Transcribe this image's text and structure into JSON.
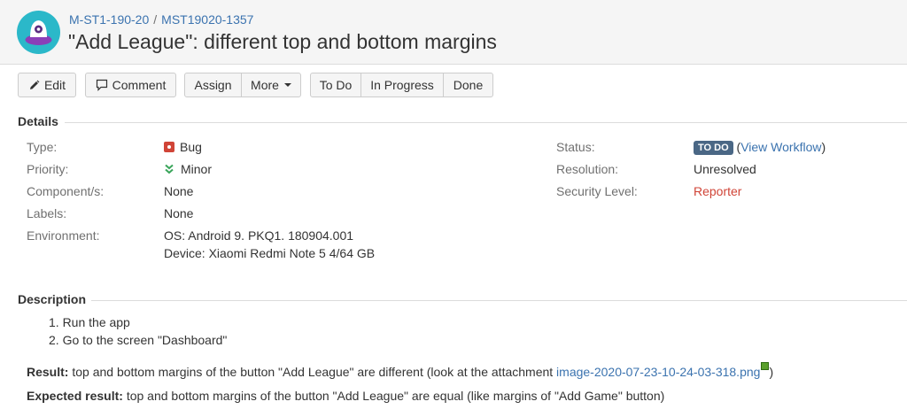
{
  "header": {
    "breadcrumb": [
      "M-ST1-190-20",
      "MST19020-1357"
    ],
    "breadcrumb_separator": "/",
    "title": "\"Add League\": different top and bottom margins",
    "avatar_icon": "project-avatar-icon"
  },
  "toolbar": {
    "edit": "Edit",
    "comment": "Comment",
    "assign": "Assign",
    "more": "More",
    "todo": "To Do",
    "in_progress": "In Progress",
    "done": "Done"
  },
  "details": {
    "heading": "Details",
    "type_label": "Type:",
    "type_value": "Bug",
    "priority_label": "Priority:",
    "priority_value": "Minor",
    "components_label": "Component/s:",
    "components_value": "None",
    "labels_label": "Labels:",
    "labels_value": "None",
    "environment_label": "Environment:",
    "environment_lines": [
      "OS: Android 9. PKQ1. 180904.001",
      "Device: Xiaomi Redmi Note 5 4/64 GB"
    ],
    "status_label": "Status:",
    "status_value": "TO DO",
    "status_open": "(",
    "status_link": "View Workflow",
    "status_close": ")",
    "resolution_label": "Resolution:",
    "resolution_value": "Unresolved",
    "security_label": "Security Level:",
    "security_value": "Reporter"
  },
  "description": {
    "heading": "Description",
    "steps": [
      "1. Run the app",
      "2. Go to the screen \"Dashboard\""
    ],
    "result_label": "Result:",
    "result_text": " top and bottom margins of the button \"Add League\" are different (look at the attachment ",
    "result_attachment": "image-2020-07-23-10-24-03-318.png",
    "result_close": ")",
    "expected_label": "Expected result:",
    "expected_text": " top and bottom margins of the button \"Add League\" are equal (like margins of \"Add Game\" button)"
  },
  "colors": {
    "link": "#3b73af",
    "bug": "#d04437",
    "status_lozenge": "#4a6785",
    "priority_minor": "#3aa55a"
  }
}
